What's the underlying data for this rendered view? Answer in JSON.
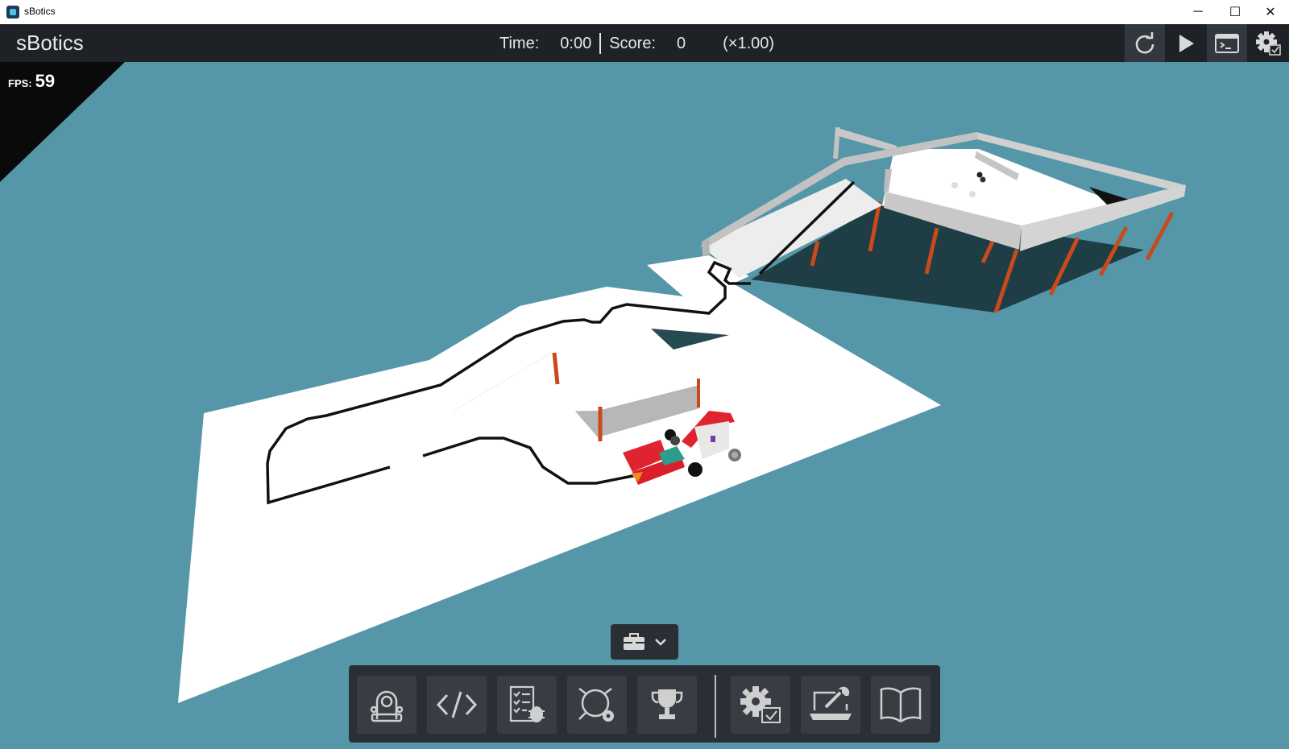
{
  "window": {
    "title": "sBotics",
    "controls": {
      "minimize": "─",
      "maximize": "☐",
      "close": "✕"
    }
  },
  "header": {
    "app_name": "sBotics",
    "time_label": "Time:",
    "time_value": "0:00",
    "score_label": "Score:",
    "score_value": "0",
    "speed": "(×1.00)",
    "buttons": [
      "reset-icon",
      "play-icon",
      "terminal-icon",
      "settings-icon"
    ]
  },
  "hud": {
    "fps_label": "FPS:",
    "fps_value": "59"
  },
  "bottom_toolbar": {
    "toggle_icons": [
      "toolbox-icon",
      "chevron-down-icon"
    ],
    "buttons": [
      "robot-icon",
      "code-icon",
      "debug-checklist-icon",
      "sensor-settings-icon",
      "trophy-icon",
      "config-settings-icon",
      "laptop-tools-icon",
      "book-icon"
    ]
  },
  "colors": {
    "background": "#5597a8",
    "header": "#1e2227",
    "toolbar": "#2a2f35",
    "floor": "#ffffff",
    "wall": "#c0c0c0",
    "pillar": "#c94a1c",
    "robot_red": "#e0242f"
  }
}
